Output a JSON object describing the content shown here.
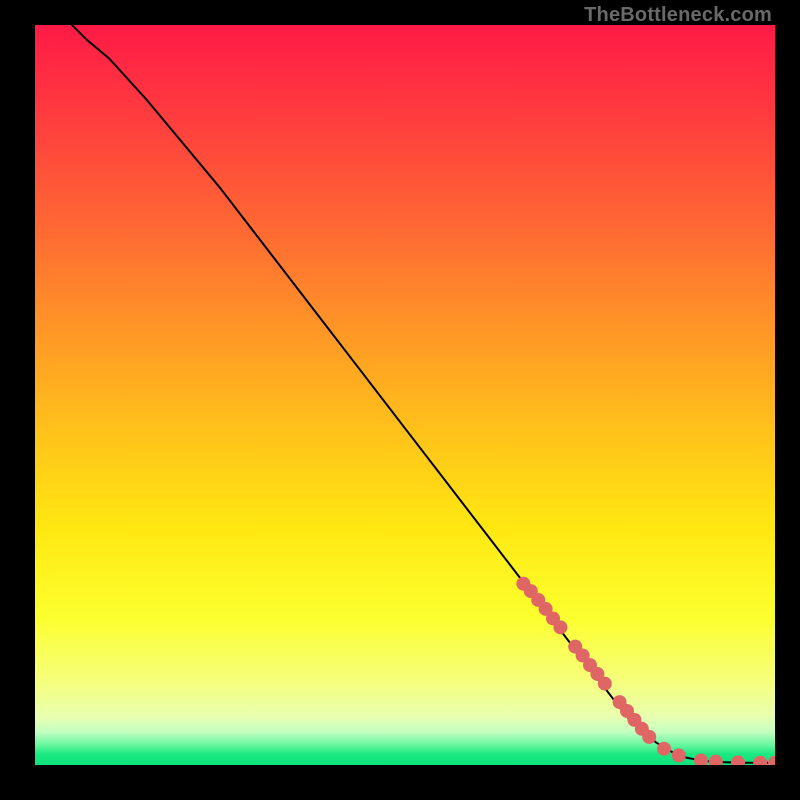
{
  "watermark": "TheBottleneck.com",
  "colors": {
    "curve": "#000000",
    "marker": "#e06666",
    "gradient_top": "#ff1744",
    "gradient_mid1": "#ff9800",
    "gradient_mid2": "#ffeb3b",
    "gradient_mid3": "#ffff66",
    "gradient_mid4": "#ccff66",
    "gradient_green": "#00e676",
    "gradient_bottom": "#00e676"
  },
  "chart_data": {
    "type": "line",
    "title": "",
    "xlabel": "",
    "ylabel": "",
    "xlim": [
      0,
      100
    ],
    "ylim": [
      0,
      100
    ],
    "curve": {
      "x": [
        5,
        7,
        10,
        15,
        20,
        25,
        30,
        35,
        40,
        45,
        50,
        55,
        60,
        65,
        70,
        75,
        80,
        82,
        84,
        86,
        88,
        90,
        92,
        94,
        96,
        98,
        100
      ],
      "y": [
        100,
        98,
        95.5,
        90,
        84,
        78,
        71.5,
        65,
        58.5,
        52,
        45.5,
        39,
        32.5,
        26,
        19.5,
        13,
        6.5,
        4.5,
        3,
        1.8,
        1.0,
        0.6,
        0.4,
        0.35,
        0.3,
        0.3,
        0.3
      ]
    },
    "series": [
      {
        "name": "markers",
        "x": [
          66,
          67,
          68,
          69,
          70,
          71,
          73,
          74,
          75,
          76,
          77,
          79,
          80,
          81,
          82,
          83,
          85,
          87,
          90,
          92,
          95,
          98,
          100
        ],
        "y": [
          24.5,
          23.5,
          22.3,
          21.1,
          19.8,
          18.6,
          16.0,
          14.8,
          13.5,
          12.3,
          11.0,
          8.5,
          7.3,
          6.1,
          4.9,
          3.8,
          2.2,
          1.3,
          0.6,
          0.45,
          0.35,
          0.3,
          0.3
        ]
      }
    ]
  }
}
